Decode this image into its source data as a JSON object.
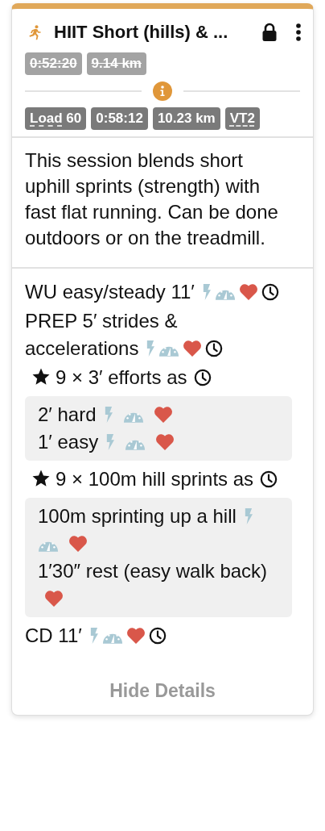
{
  "card": {
    "title": "HIIT Short (hills) & ...",
    "locked": true
  },
  "planned_stats": [
    {
      "value": "0:52:20",
      "struck": true
    },
    {
      "value": "9.14 km",
      "struck": true
    }
  ],
  "stats": [
    {
      "label": "Load",
      "value": "60"
    },
    {
      "value": "0:58:12"
    },
    {
      "value": "10.23 km"
    },
    {
      "label": "VT2"
    }
  ],
  "description": "This session blends short uphill sprints (strength) with fast flat running. Can be done outdoors or on the treadmill.",
  "steps": [
    {
      "kind": "step",
      "text": "WU easy/steady 11′",
      "power": true,
      "pace": true,
      "heart_rate": true,
      "timer": true
    },
    {
      "kind": "step",
      "text": "PREP 5′ strides & accelerations",
      "power": true,
      "pace": true,
      "heart_rate": true,
      "timer": true
    },
    {
      "kind": "repeat",
      "text": "9 × 3′ efforts as",
      "timer": true,
      "children": [
        {
          "text": "2′ hard",
          "power": true,
          "pace": true,
          "heart_rate": true
        },
        {
          "text": "1′ easy",
          "power": true,
          "pace": true,
          "heart_rate": true
        }
      ]
    },
    {
      "kind": "repeat",
      "text": "9 × 100m hill sprints as",
      "timer": true,
      "children": [
        {
          "text": "100m sprinting up a hill",
          "power": true,
          "pace": true,
          "heart_rate": true
        },
        {
          "text": "1′30″ rest (easy walk back)",
          "power": false,
          "pace": false,
          "heart_rate": true
        }
      ]
    },
    {
      "kind": "step",
      "text": "CD 11′",
      "power": true,
      "pace": true,
      "heart_rate": true,
      "timer": true
    }
  ],
  "footer": {
    "link": "Hide Details"
  }
}
